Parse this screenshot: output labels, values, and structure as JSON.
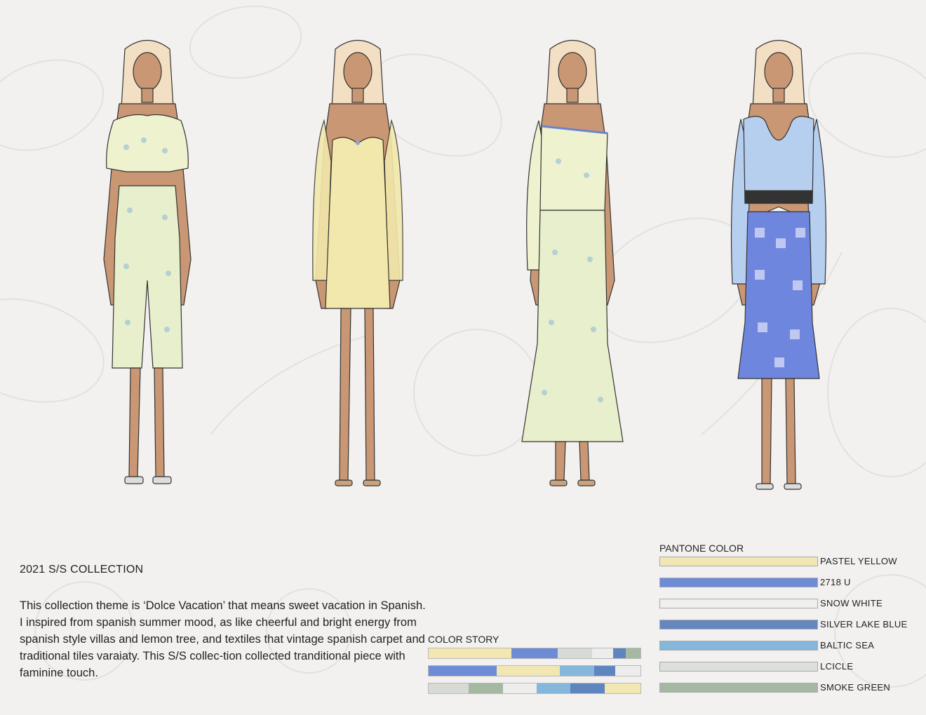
{
  "collection": {
    "title": "2021 S/S COLLECTION",
    "description_lines": [
      "This collection theme is ‘Dolce Vacation’ that means sweet vacation in Spanish.",
      "I inspired from spanish summer mood, as like cheerful and bright energy from spanish style villas and lemon tree, and textiles that vintage spanish carpet and traditional tiles varaiaty. This S/S collec-tion collected tranditional piece with faminine touch."
    ]
  },
  "color_story": {
    "title": "COLOR STORY",
    "bars": [
      [
        {
          "color": "#f2e7b3",
          "share": 0.39
        },
        {
          "color": "#6e8bd6",
          "share": 0.22
        },
        {
          "color": "#d8dad6",
          "share": 0.16
        },
        {
          "color": "#ededed",
          "share": 0.1
        },
        {
          "color": "#5f85bf",
          "share": 0.06
        },
        {
          "color": "#a5b9a2",
          "share": 0.07
        }
      ],
      [
        {
          "color": "#6e8bd6",
          "share": 0.32
        },
        {
          "color": "#f2e7b3",
          "share": 0.3
        },
        {
          "color": "#85b6dc",
          "share": 0.16
        },
        {
          "color": "#5f85bf",
          "share": 0.1
        },
        {
          "color": "#ededed",
          "share": 0.12
        }
      ],
      [
        {
          "color": "#d8dad6",
          "share": 0.19
        },
        {
          "color": "#a5b9a2",
          "share": 0.16
        },
        {
          "color": "#ededed",
          "share": 0.16
        },
        {
          "color": "#85b6dc",
          "share": 0.16
        },
        {
          "color": "#5f85bf",
          "share": 0.16
        },
        {
          "color": "#f2e7b3",
          "share": 0.17
        }
      ]
    ]
  },
  "pantone": {
    "title": "PANTONE COLOR",
    "items": [
      {
        "label": "PASTEL YELLOW",
        "color": "#f2e7b3"
      },
      {
        "label": "2718 U",
        "color": "#6e8bd6"
      },
      {
        "label": "SNOW WHITE",
        "color": "#efefed"
      },
      {
        "label": "SILVER LAKE BLUE",
        "color": "#6487bf"
      },
      {
        "label": "BALTIC SEA",
        "color": "#85b6dc"
      },
      {
        "label": "LCICLE",
        "color": "#dcdfdc"
      },
      {
        "label": "SMOKE GREEN",
        "color": "#a5b9a2"
      }
    ]
  },
  "looks": [
    {
      "name": "look-1-tile-print-crop-top-and-culottes",
      "top_color": "#eef2cf",
      "bottom_color": "#e8efcc",
      "accent": "#9fc3d6"
    },
    {
      "name": "look-2-pastel-yellow-mini-dress",
      "top_color": "#f3e8ab",
      "bottom_color": "#f3e8ab",
      "accent": "#8aa6e0"
    },
    {
      "name": "look-3-one-shoulder-tile-print-dress",
      "top_color": "#eef2cf",
      "bottom_color": "#e8efcc",
      "accent": "#6a84d0"
    },
    {
      "name": "look-4-baltic-cardigan-and-blue-print-skirt",
      "top_color": "#b7cfef",
      "bottom_color": "#6f86df",
      "accent": "#ffffff"
    }
  ],
  "colors": {
    "skin": "#c99774",
    "hair": "#f3dfc4",
    "outline": "#333333"
  }
}
